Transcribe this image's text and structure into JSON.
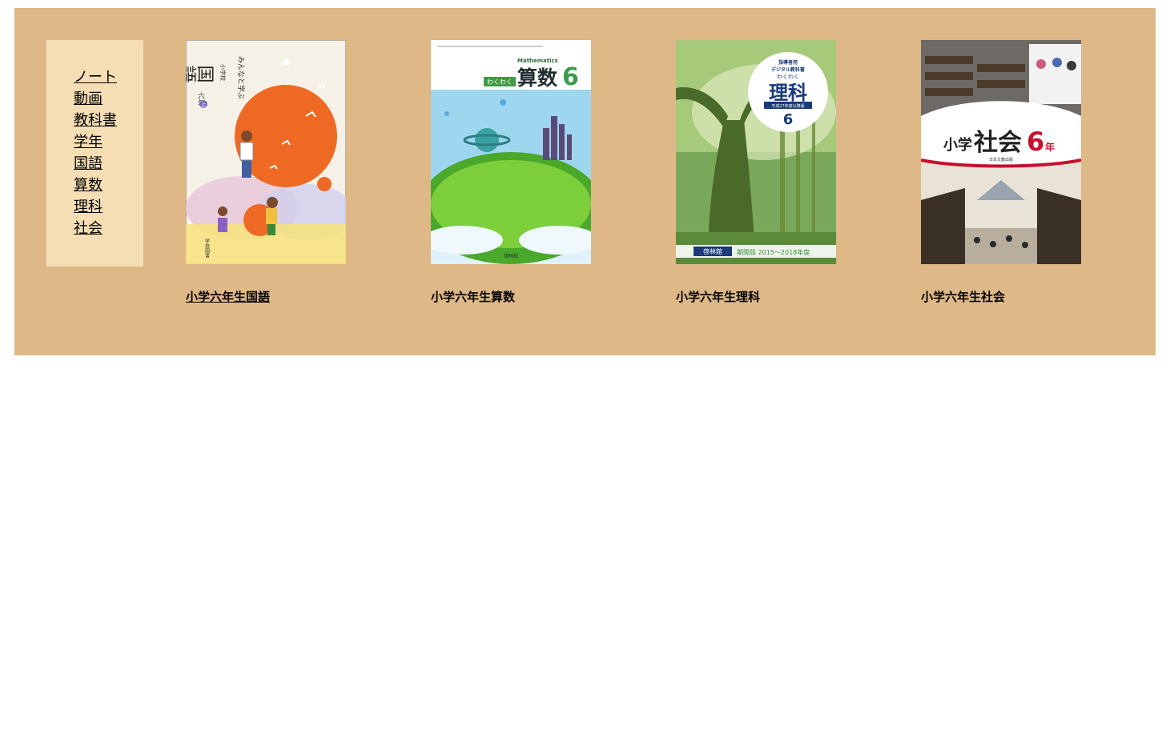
{
  "nav": {
    "items": [
      {
        "label": "ノート"
      },
      {
        "label": "動画"
      },
      {
        "label": "教科書"
      },
      {
        "label": "学年"
      },
      {
        "label": "国語"
      },
      {
        "label": "算数"
      },
      {
        "label": "理科"
      },
      {
        "label": "社会"
      }
    ]
  },
  "colors": {
    "panel_background": "#deb887",
    "sidebar_background": "#f5deb3",
    "page_background": "#ffffff"
  },
  "books": [
    {
      "title": "小学六年生国語",
      "cover": {
        "school_text": "小学校",
        "series_text": "みんなと学ぶ",
        "subject_text": "国語",
        "grade_text": "六年",
        "volume_badge": "上",
        "publisher_text": "学校図書"
      }
    },
    {
      "title": "小学六年生算数",
      "cover": {
        "english_text": "Mathematics",
        "badge_text": "わくわく",
        "subject_text": "算数",
        "grade_number": "6",
        "publisher_text": "啓林館"
      }
    },
    {
      "title": "小学六年生理科",
      "cover": {
        "top_text_1": "指導者用",
        "top_text_2": "デジタル教科書",
        "badge_text": "わくわく",
        "subject_text": "理科",
        "edition_text": "平成27年度以降版",
        "grade_number": "6",
        "publisher_text": "啓林館",
        "period_text": "期間版 2015～2018年度"
      }
    },
    {
      "title": "小学六年生社会",
      "cover": {
        "prefix_text": "小学",
        "subject_text": "社会",
        "grade_number": "6",
        "suffix_text": "年",
        "publisher_text": "日本文教出版"
      }
    }
  ]
}
